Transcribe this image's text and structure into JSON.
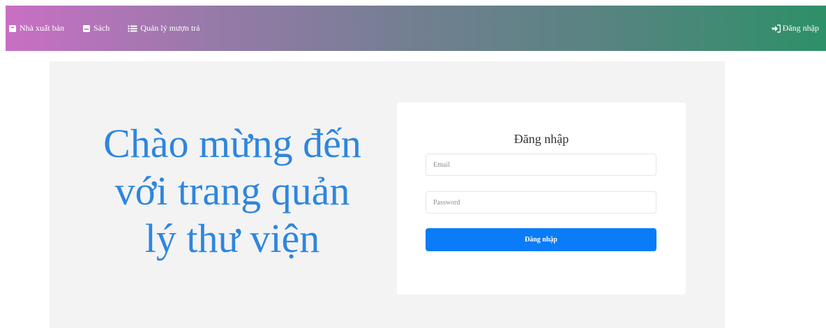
{
  "navbar": {
    "items": [
      {
        "label": "Nhà xuất bản",
        "icon": "book-icon"
      },
      {
        "label": "Sách",
        "icon": "bookmark-icon"
      },
      {
        "label": "Quản lý mượn trả",
        "icon": "list-icon"
      }
    ],
    "login_label": "Đăng nhập",
    "login_icon": "sign-in-icon",
    "gradient": [
      "#c96fc4",
      "#2d9068"
    ]
  },
  "hero": {
    "welcome_line1": "Chào mừng đến",
    "welcome_line2": "với trang quản",
    "welcome_line3": "lý thư viện",
    "accent_color": "#2e86de"
  },
  "login": {
    "title": "Đăng nhập",
    "email_placeholder": "Email",
    "password_placeholder": "Password",
    "submit_label": "Đăng nhập",
    "button_color": "#0a7cf8"
  }
}
